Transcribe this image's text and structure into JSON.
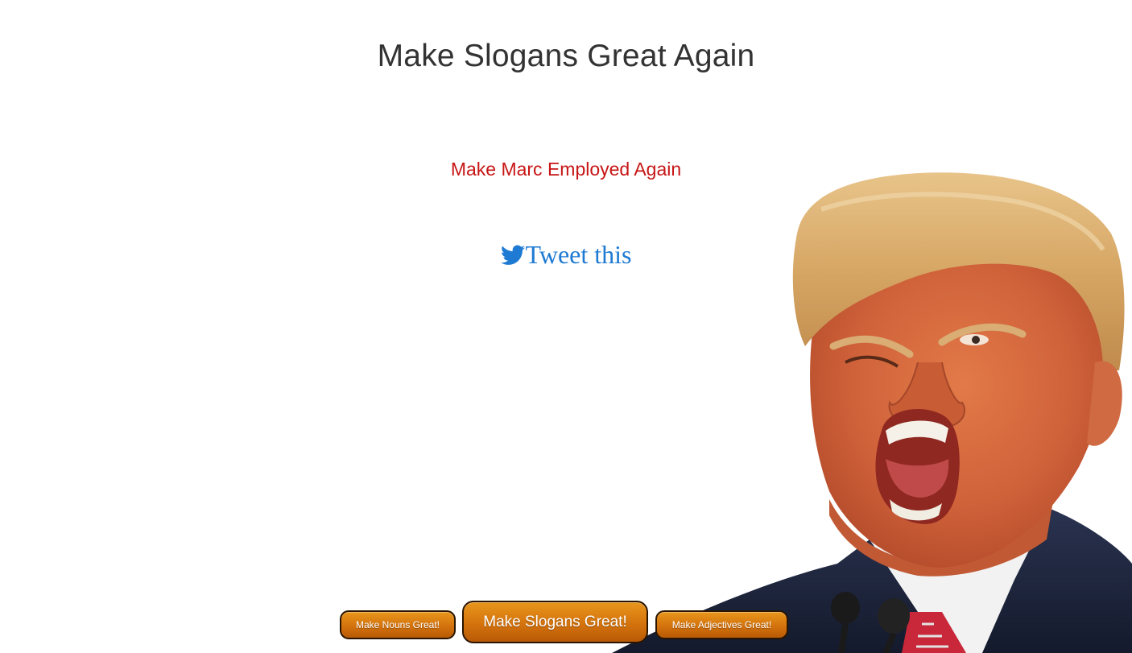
{
  "page": {
    "title": "Make Slogans Great Again",
    "slogan": "Make Marc Employed Again",
    "tweet_label": "Tweet this"
  },
  "buttons": {
    "nouns": "Make Nouns Great!",
    "slogans": "Make Slogans Great!",
    "adjectives": "Make Adjectives Great!"
  },
  "icons": {
    "tweet": "twitter-bird-icon"
  },
  "colors": {
    "title": "#333333",
    "slogan": "#c71515",
    "tweet_link": "#1e7ad2",
    "button_fill": "#d4730d",
    "button_border": "#2a1500"
  }
}
